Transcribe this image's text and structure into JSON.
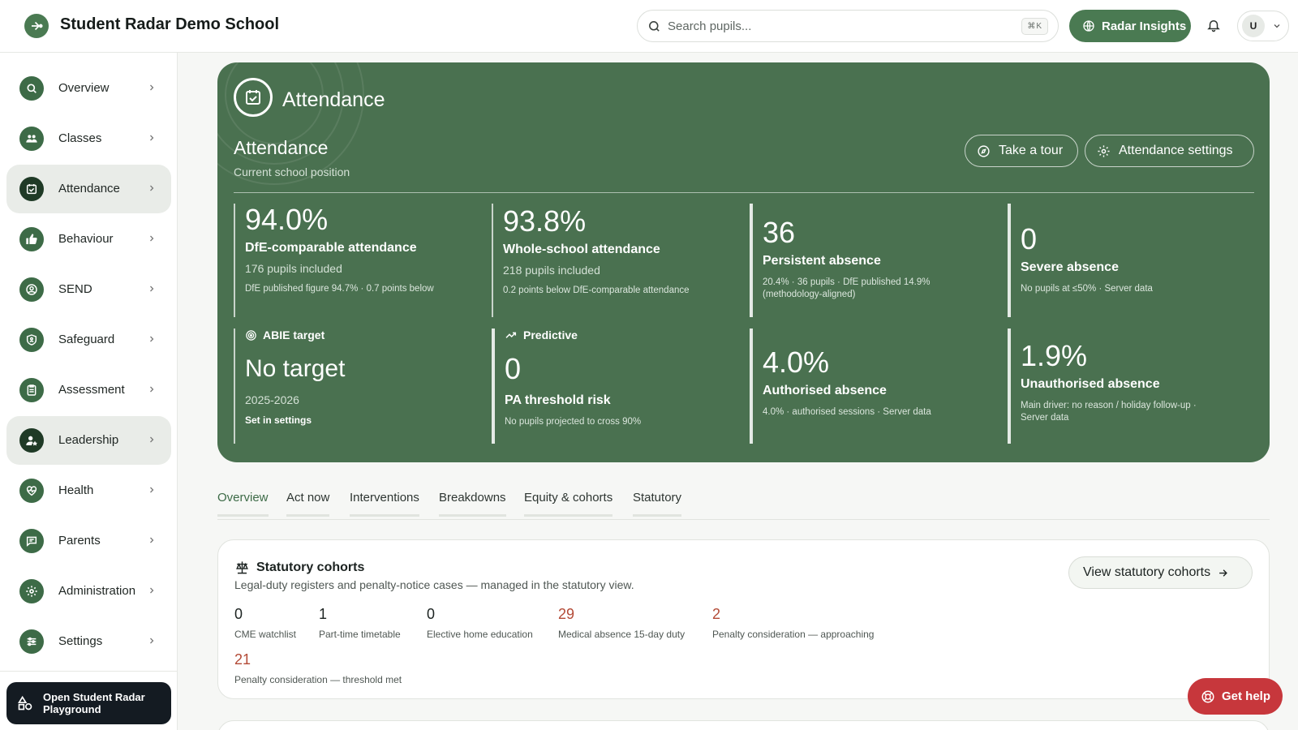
{
  "header": {
    "school_name": "Student Radar Demo School",
    "search_placeholder": "Search pupils...",
    "search_shortcut": "⌘K",
    "insights_label": "Radar Insights",
    "user_initial": "U"
  },
  "sidebar": {
    "items": [
      {
        "label": "Overview",
        "icon": "search-icon"
      },
      {
        "label": "Classes",
        "icon": "users-icon"
      },
      {
        "label": "Attendance",
        "icon": "calendar-check-icon",
        "active": true
      },
      {
        "label": "Behaviour",
        "icon": "thumbs-up-icon"
      },
      {
        "label": "SEND",
        "icon": "person-circle-icon"
      },
      {
        "label": "Safeguard",
        "icon": "shield-icon"
      },
      {
        "label": "Assessment",
        "icon": "clipboard-icon"
      },
      {
        "label": "Leadership",
        "icon": "user-star-icon",
        "active": true
      },
      {
        "label": "Health",
        "icon": "heart-pulse-icon"
      },
      {
        "label": "Parents",
        "icon": "chat-icon"
      },
      {
        "label": "Administration",
        "icon": "gear-icon"
      },
      {
        "label": "Settings",
        "icon": "sliders-icon"
      }
    ],
    "playground_label": "Open Student Radar Playground"
  },
  "hero": {
    "module_title": "Attendance",
    "section_title": "Attendance",
    "section_subtitle": "Current school position",
    "tour_label": "Take a tour",
    "settings_label": "Attendance settings",
    "stats": [
      {
        "value": "94.0%",
        "label": "DfE-comparable attendance",
        "sub": "176 pupils included",
        "note": "DfE published figure 94.7% · 0.7 points below"
      },
      {
        "value": "93.8%",
        "label": "Whole-school attendance",
        "sub": "218 pupils included",
        "note": "0.2 points below DfE-comparable attendance"
      },
      {
        "value": "36",
        "label": "Persistent absence",
        "note": "20.4% · 36 pupils · DfE published 14.9% (methodology-aligned)"
      },
      {
        "value": "0",
        "label": "Severe absence",
        "note": "No pupils at ≤50% · Server data"
      },
      {
        "head": "ABIE target",
        "value": "No target",
        "sub": "2025-2026",
        "note": "Set in settings"
      },
      {
        "head": "Predictive",
        "value": "0",
        "label": "PA threshold risk",
        "note": "No pupils projected to cross 90%"
      },
      {
        "value": "4.0%",
        "label": "Authorised absence",
        "note": "4.0% · authorised sessions · Server data"
      },
      {
        "value": "1.9%",
        "label": "Unauthorised absence",
        "note": "Main driver: no reason / holiday follow-up · Server data"
      }
    ]
  },
  "tabs": [
    "Overview",
    "Act now",
    "Interventions",
    "Breakdowns",
    "Equity & cohorts",
    "Statutory"
  ],
  "statutory": {
    "title": "Statutory cohorts",
    "description": "Legal-duty registers and penalty-notice cases — managed in the statutory view.",
    "view_label": "View statutory cohorts",
    "cohorts": [
      {
        "value": "0",
        "label": "CME watchlist"
      },
      {
        "value": "1",
        "label": "Part-time timetable"
      },
      {
        "value": "0",
        "label": "Elective home education"
      },
      {
        "value": "29",
        "label": "Medical absence 15-day duty",
        "warn": true
      },
      {
        "value": "2",
        "label": "Penalty consideration — approaching",
        "warn": true
      },
      {
        "value": "21",
        "label": "Penalty consideration — threshold met",
        "warn": true
      }
    ]
  },
  "help_label": "Get help",
  "colors": {
    "brand": "#4a7150",
    "accent": "#4a7a52",
    "warn": "#b34a36",
    "help": "#c7373c"
  }
}
